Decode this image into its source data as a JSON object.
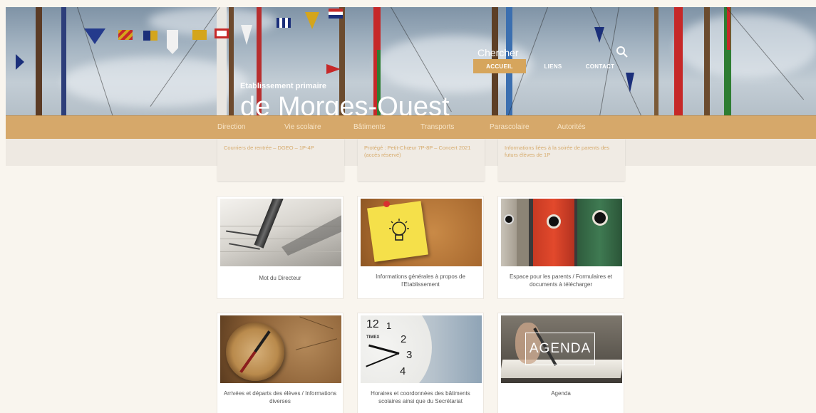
{
  "header": {
    "search_label": "Chercher",
    "top_nav": [
      "ACCUEIL",
      "LIENS",
      "CONTACT"
    ],
    "subtitle": "Etablissement primaire",
    "title": "de Morges-Ouest"
  },
  "main_nav": [
    "Direction",
    "Vie scolaire",
    "Bâtiments",
    "Transports",
    "Parascolaire",
    "Autorités"
  ],
  "news": [
    {
      "text": "Courriers de rentrée – DGEO – 1P-4P"
    },
    {
      "text": "Protégé : Petit-Chœur 7P-8P – Concert 2021 (accès réservé)"
    },
    {
      "text": "Informations liées à la soirée de parents des futurs élèves de 1P"
    }
  ],
  "tiles": [
    {
      "caption": "Mot du Directeur"
    },
    {
      "caption": "Informations générales à propos de l'Etablissement"
    },
    {
      "caption": "Espace pour les parents / Formulaires et documents à télécharger"
    },
    {
      "caption": "Arrivées et départs des élèves / Informations diverses"
    },
    {
      "caption": "Horaires et coordonnées des bâtiments scolaires ainsi que du Secrétariat"
    },
    {
      "caption": "Agenda",
      "image_text": "AGENDA"
    }
  ],
  "colors": {
    "accent": "#d6a55c",
    "nav_bar": "#d6a86a",
    "news_text": "#d6ab6d",
    "page_bg": "#f9f5ee"
  },
  "icons": {
    "search": "search-icon"
  }
}
